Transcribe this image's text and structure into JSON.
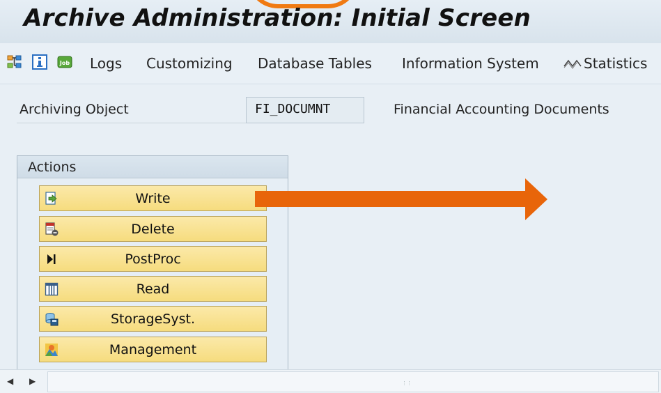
{
  "window": {
    "title": "Archive Administration: Initial Screen"
  },
  "toolbar": {
    "icons": [
      "hierarchy-icon",
      "info-icon",
      "job-icon"
    ],
    "job_icon_text": "Job",
    "items": [
      "Logs",
      "Customizing",
      "Database Tables",
      "Information System"
    ],
    "statistics_icon": "statistics-icon",
    "statistics_label": "Statistics"
  },
  "field": {
    "label": "Archiving Object",
    "value": "FI_DOCUMNT",
    "description": "Financial Accounting Documents"
  },
  "actions": {
    "header": "Actions",
    "buttons": [
      {
        "label": "Write",
        "icon": "write-icon"
      },
      {
        "label": "Delete",
        "icon": "delete-icon"
      },
      {
        "label": "PostProc",
        "icon": "postproc-icon"
      },
      {
        "label": "Read",
        "icon": "read-icon"
      },
      {
        "label": "StorageSyst.",
        "icon": "storage-system-icon"
      },
      {
        "label": "Management",
        "icon": "management-icon"
      }
    ]
  },
  "colors": {
    "accent_orange": "#e8650a",
    "button_yellow": "#f8e394",
    "background": "#e8eff5"
  }
}
